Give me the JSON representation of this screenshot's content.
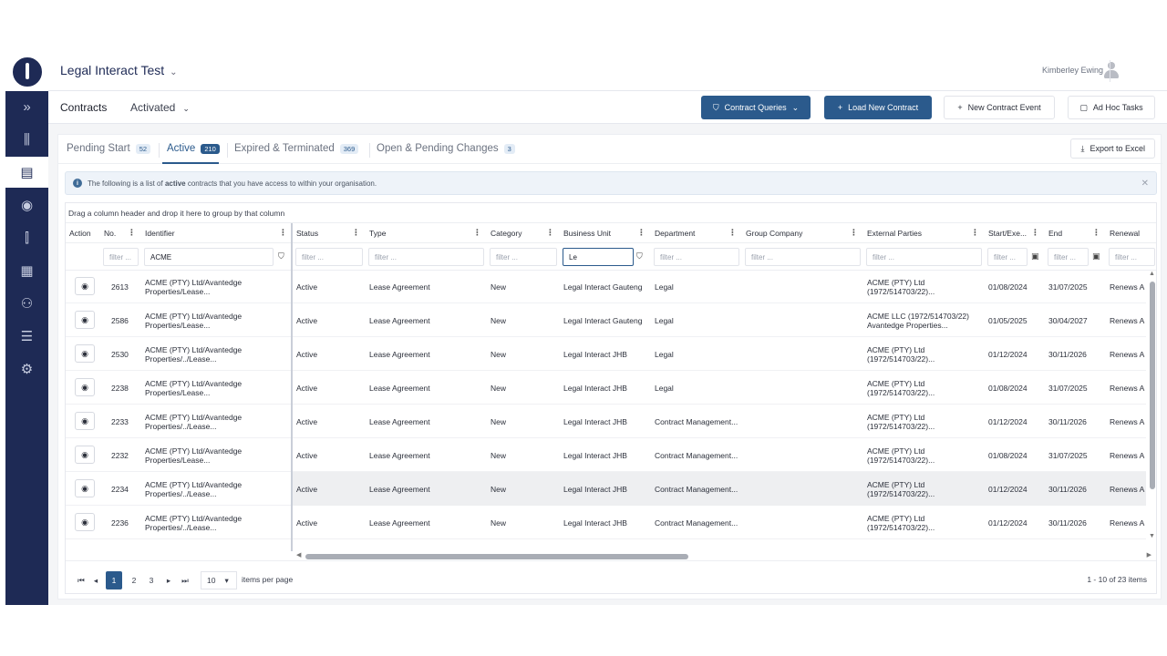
{
  "header": {
    "app_title": "Legal Interact Test",
    "user_name": "Kimberley Ewing"
  },
  "sidebar": {
    "items": [
      {
        "icon": "chevrons-right-icon",
        "glyph": "»"
      },
      {
        "icon": "chart-icon",
        "glyph": "⫼"
      },
      {
        "icon": "documents-icon",
        "glyph": "▤"
      },
      {
        "icon": "stopwatch-icon",
        "glyph": "◉"
      },
      {
        "icon": "building-icon",
        "glyph": "⫿"
      },
      {
        "icon": "office-icon",
        "glyph": "▦"
      },
      {
        "icon": "people-icon",
        "glyph": "⚇"
      },
      {
        "icon": "list-icon",
        "glyph": "☰"
      },
      {
        "icon": "settings-icon",
        "glyph": "⚙"
      }
    ]
  },
  "toolbar": {
    "title": "Contracts",
    "view": "Activated",
    "contract_queries": "Contract Queries",
    "load_new_contract": "Load New Contract",
    "new_contract_event": "New Contract Event",
    "ad_hoc_tasks": "Ad Hoc Tasks"
  },
  "tabs": [
    {
      "label": "Pending Start",
      "count": "52"
    },
    {
      "label": "Active",
      "count": "210"
    },
    {
      "label": "Expired & Terminated",
      "count": "369"
    },
    {
      "label": "Open & Pending Changes",
      "count": "3"
    }
  ],
  "export_label": "Export to Excel",
  "info": {
    "prefix": "The following is a list of ",
    "bold": "active",
    "suffix": " contracts that you have access to within your organisation."
  },
  "grid": {
    "group_hint": "Drag a column header and drop it here to group by that column",
    "columns": [
      "Action",
      "No.",
      "Identifier",
      "Status",
      "Type",
      "Category",
      "Business Unit",
      "Department",
      "Group Company",
      "External Parties",
      "Start/Exe...",
      "End",
      "Renewal"
    ],
    "filters": {
      "placeholder": "filter ...",
      "identifier": "ACME",
      "business_unit": "Le"
    },
    "rows": [
      {
        "no": "2613",
        "identifier": "ACME (PTY) Ltd/Avantedge Properties/Lease...",
        "status": "Active",
        "type": "Lease Agreement",
        "category": "New",
        "business_unit": "Legal Interact Gauteng",
        "department": "Legal",
        "group_company": "",
        "external": "ACME (PTY) Ltd (1972/514703/22)...",
        "start": "01/08/2024",
        "end": "31/07/2025",
        "renewal": "Renews A"
      },
      {
        "no": "2586",
        "identifier": "ACME (PTY) Ltd/Avantedge Properties/Lease...",
        "status": "Active",
        "type": "Lease Agreement",
        "category": "New",
        "business_unit": "Legal Interact Gauteng",
        "department": "Legal",
        "group_company": "",
        "external": "ACME LLC (1972/514703/22) Avantedge Properties...",
        "start": "01/05/2025",
        "end": "30/04/2027",
        "renewal": "Renews A"
      },
      {
        "no": "2530",
        "identifier": "ACME (PTY) Ltd/Avantedge Properties/../Lease...",
        "status": "Active",
        "type": "Lease Agreement",
        "category": "New",
        "business_unit": "Legal Interact JHB",
        "department": "Legal",
        "group_company": "",
        "external": "ACME (PTY) Ltd (1972/514703/22)...",
        "start": "01/12/2024",
        "end": "30/11/2026",
        "renewal": "Renews A"
      },
      {
        "no": "2238",
        "identifier": "ACME (PTY) Ltd/Avantedge Properties/Lease...",
        "status": "Active",
        "type": "Lease Agreement",
        "category": "New",
        "business_unit": "Legal Interact JHB",
        "department": "Legal",
        "group_company": "",
        "external": "ACME (PTY) Ltd (1972/514703/22)...",
        "start": "01/08/2024",
        "end": "31/07/2025",
        "renewal": "Renews A"
      },
      {
        "no": "2233",
        "identifier": "ACME (PTY) Ltd/Avantedge Properties/../Lease...",
        "status": "Active",
        "type": "Lease Agreement",
        "category": "New",
        "business_unit": "Legal Interact JHB",
        "department": "Contract Management...",
        "group_company": "",
        "external": "ACME (PTY) Ltd (1972/514703/22)...",
        "start": "01/12/2024",
        "end": "30/11/2026",
        "renewal": "Renews A"
      },
      {
        "no": "2232",
        "identifier": "ACME (PTY) Ltd/Avantedge Properties/Lease...",
        "status": "Active",
        "type": "Lease Agreement",
        "category": "New",
        "business_unit": "Legal Interact JHB",
        "department": "Contract Management...",
        "group_company": "",
        "external": "ACME (PTY) Ltd (1972/514703/22)...",
        "start": "01/08/2024",
        "end": "31/07/2025",
        "renewal": "Renews A"
      },
      {
        "no": "2234",
        "identifier": "ACME (PTY) Ltd/Avantedge Properties/../Lease...",
        "status": "Active",
        "type": "Lease Agreement",
        "category": "New",
        "business_unit": "Legal Interact JHB",
        "department": "Contract Management...",
        "group_company": "",
        "external": "ACME (PTY) Ltd (1972/514703/22)...",
        "start": "01/12/2024",
        "end": "30/11/2026",
        "renewal": "Renews A"
      },
      {
        "no": "2236",
        "identifier": "ACME (PTY) Ltd/Avantedge Properties/../Lease...",
        "status": "Active",
        "type": "Lease Agreement",
        "category": "New",
        "business_unit": "Legal Interact JHB",
        "department": "Contract Management...",
        "group_company": "",
        "external": "ACME (PTY) Ltd (1972/514703/22)...",
        "start": "01/12/2024",
        "end": "30/11/2026",
        "renewal": "Renews A"
      }
    ],
    "highlighted_row": 6
  },
  "pager": {
    "pages": [
      "1",
      "2",
      "3"
    ],
    "current": "1",
    "page_size": "10",
    "items_per_page": "items per page",
    "info": "1 - 10 of 23 items"
  },
  "colors": {
    "sidebar": "#1e2a55",
    "primary": "#2b5a8c"
  }
}
